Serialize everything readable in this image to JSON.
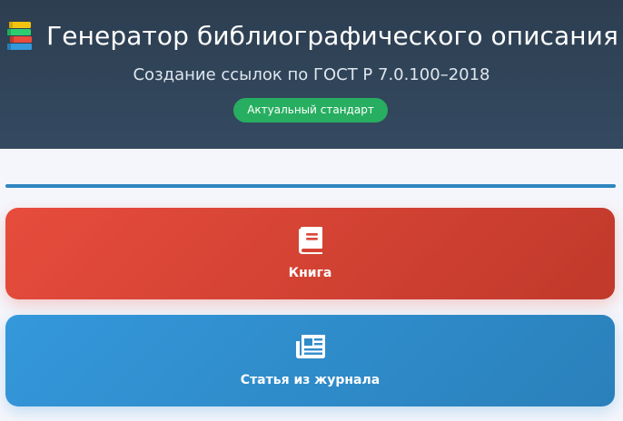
{
  "header": {
    "title": "Генератор библиографического описания",
    "subtitle": "Создание ссылок по ГОСТ Р 7.0.100–2018",
    "badge": "Актуальный стандарт",
    "icon": "books-icon"
  },
  "source_types": [
    {
      "label": "Книга",
      "icon": "book-icon",
      "color": "#e74c3c"
    },
    {
      "label": "Статья из журнала",
      "icon": "newspaper-icon",
      "color": "#3498db"
    }
  ],
  "colors": {
    "header_bg": "#2d3e50",
    "badge_bg": "#27ae60",
    "progress": "#2e86c1",
    "page_bg": "#f5f6fb"
  }
}
